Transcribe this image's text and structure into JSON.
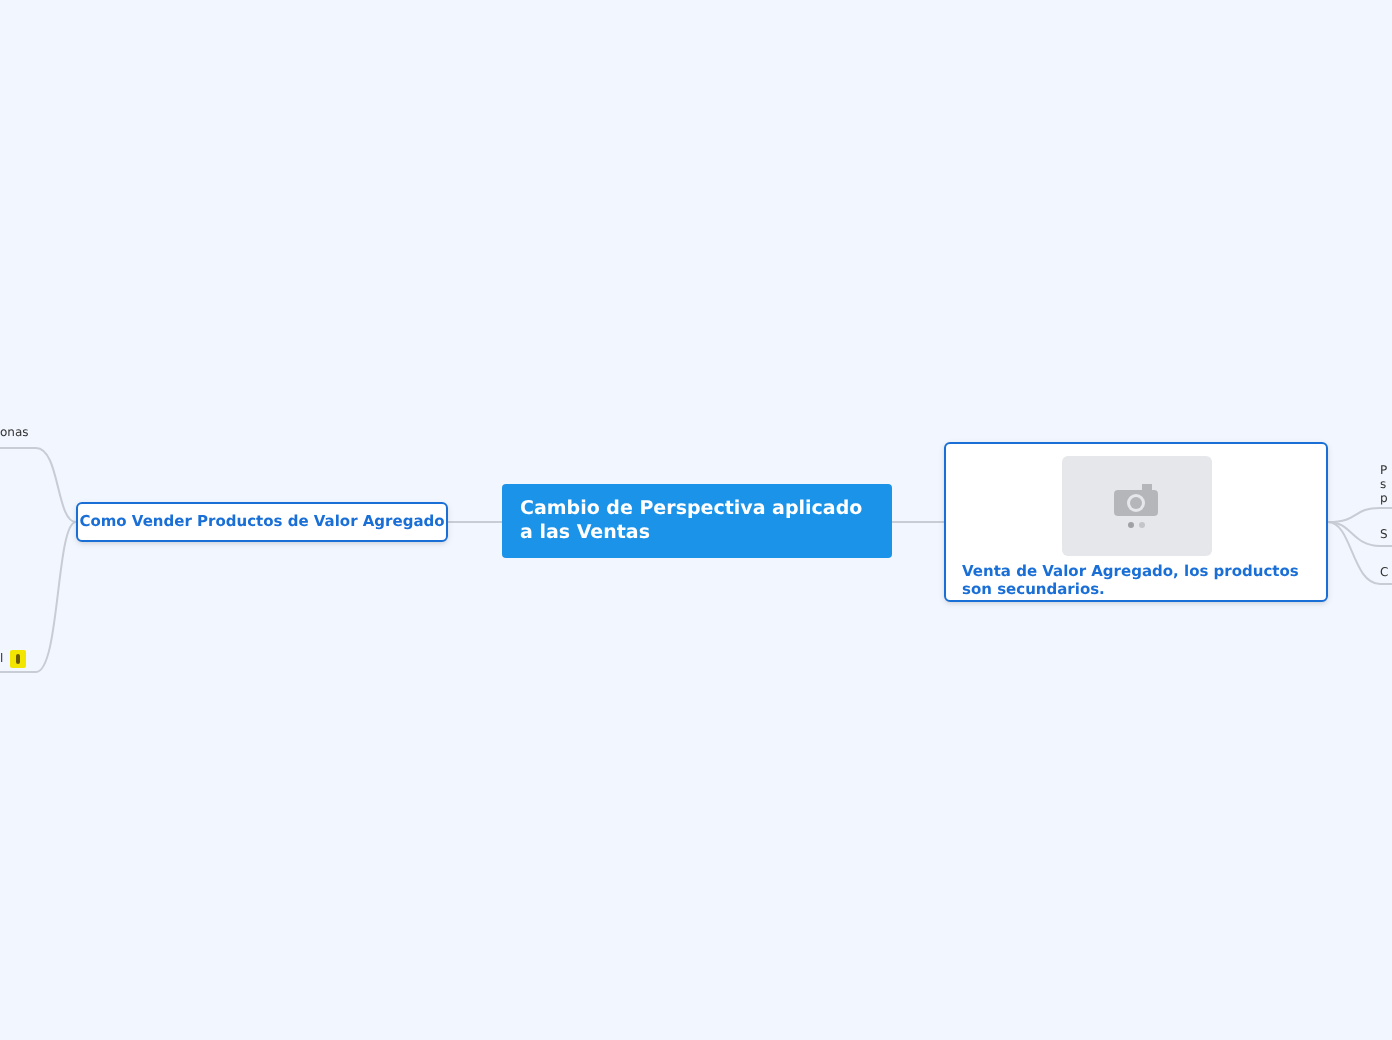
{
  "central_topic": {
    "title": "Cambio de Perspectiva aplicado a las Ventas"
  },
  "left_branch": {
    "title": "Como Vender Productos de Valor Agregado",
    "subtopics": [
      {
        "text": "onas",
        "warning": false
      },
      {
        "text": "l",
        "warning": true
      }
    ]
  },
  "right_branch": {
    "title": "Venta de Valor Agregado, los productos son secundarios.",
    "image": true,
    "subtopics": [
      {
        "text": "P\ns\np"
      },
      {
        "text": "S"
      },
      {
        "text": "C"
      }
    ]
  }
}
